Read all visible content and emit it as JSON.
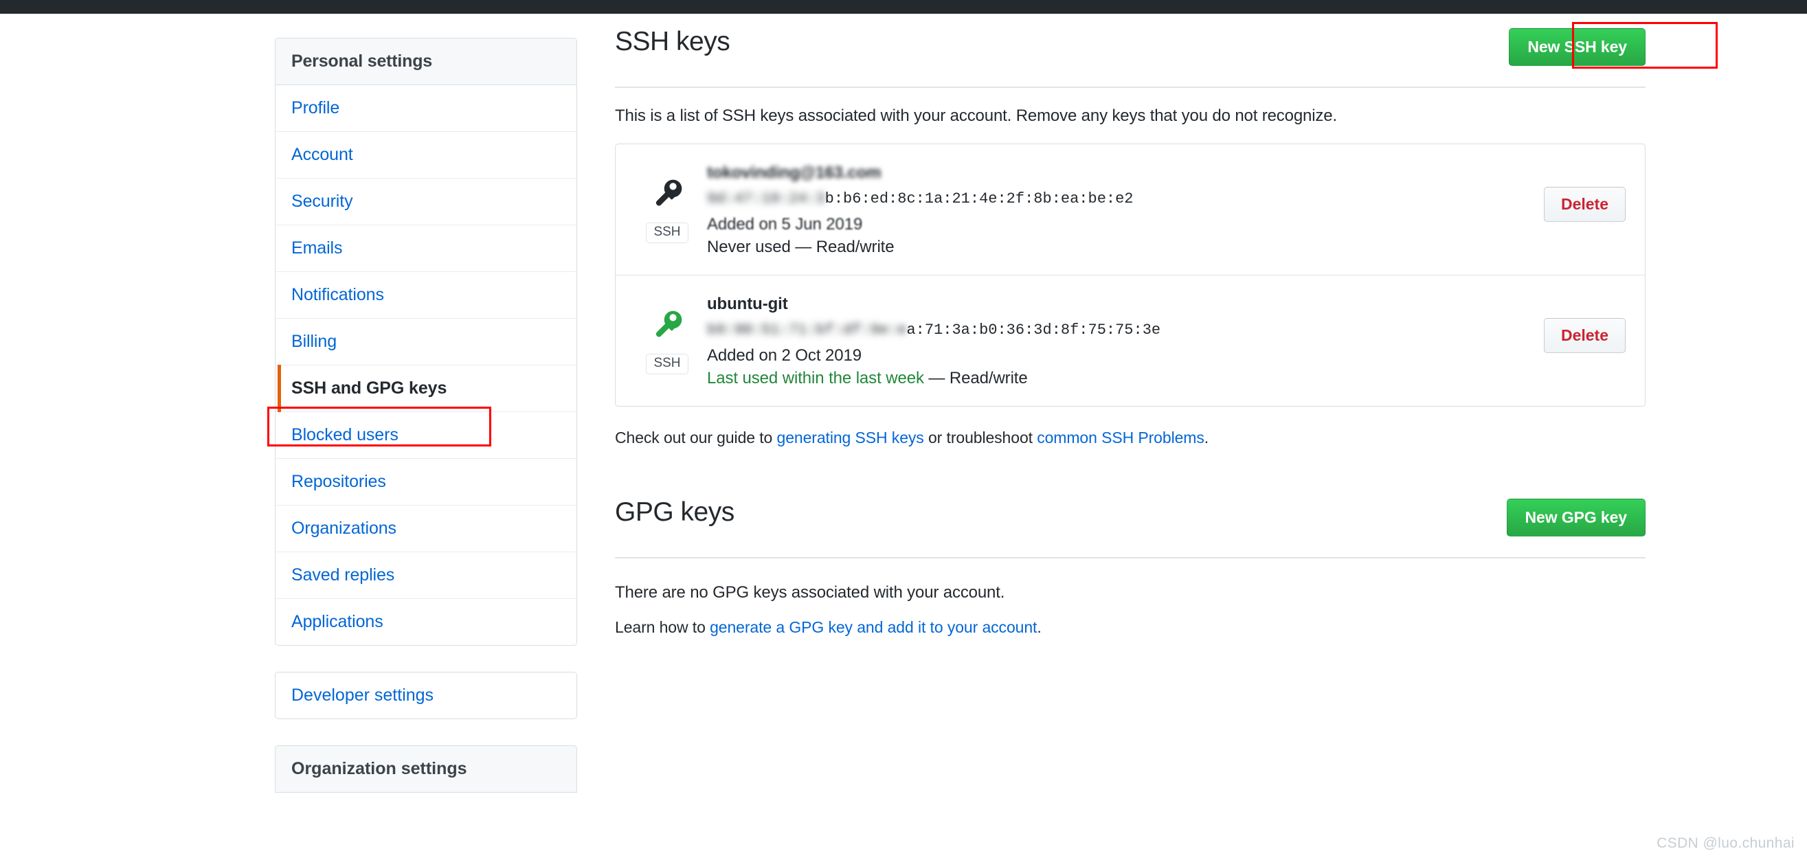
{
  "topbar": {
    "color": "#24292e"
  },
  "sidebar": {
    "personal": {
      "header": "Personal settings",
      "items": [
        {
          "label": "Profile",
          "selected": false
        },
        {
          "label": "Account",
          "selected": false
        },
        {
          "label": "Security",
          "selected": false
        },
        {
          "label": "Emails",
          "selected": false
        },
        {
          "label": "Notifications",
          "selected": false
        },
        {
          "label": "Billing",
          "selected": false
        },
        {
          "label": "SSH and GPG keys",
          "selected": true
        },
        {
          "label": "Blocked users",
          "selected": false
        },
        {
          "label": "Repositories",
          "selected": false
        },
        {
          "label": "Organizations",
          "selected": false
        },
        {
          "label": "Saved replies",
          "selected": false
        },
        {
          "label": "Applications",
          "selected": false
        }
      ]
    },
    "developer_settings": "Developer settings",
    "organization_settings": "Organization settings",
    "selected_indicator_color": "#e36209",
    "link_color": "#0366d6"
  },
  "ssh_section": {
    "title": "SSH keys",
    "new_key_button": "New SSH key",
    "description": "This is a list of SSH keys associated with your account. Remove any keys that you do not recognize.",
    "keys": [
      {
        "title": "tokovinding@163.com",
        "title_blurred": true,
        "fingerprint": "9d:47:19:24:3b:b6:ed:8c:1a:21:4e:2f:8b:ea:be:e2",
        "fingerprint_visible_tail": "b:b6:ed:8c:1a:21:4e:2f:8b:ea:be:e2",
        "added": "Added on 5 Jun 2019",
        "used_text": "Never used",
        "used_color": "#24292e",
        "permission": "Read/write",
        "badge": "SSH",
        "icon": "key-icon",
        "icon_color": "#24292e",
        "delete_label": "Delete"
      },
      {
        "title": "ubuntu-git",
        "title_blurred": false,
        "fingerprint": "b9:90:51:71:bf:df:9e:ea:71:3a:b0:36:3d:8f:75:75:3e",
        "fingerprint_visible_tail": "a:71:3a:b0:36:3d:8f:75:75:3e",
        "added": "Added on 2 Oct 2019",
        "used_text": "Last used within the last week",
        "used_color": "#22863a",
        "permission": "Read/write",
        "badge": "SSH",
        "icon": "key-icon",
        "icon_color": "#28a745",
        "delete_label": "Delete"
      }
    ],
    "guide": {
      "prefix": "Check out our guide to ",
      "link1": "generating SSH keys",
      "middle": " or troubleshoot ",
      "link2": "common SSH Problems",
      "suffix": "."
    }
  },
  "gpg_section": {
    "title": "GPG keys",
    "new_key_button": "New GPG key",
    "empty_message": "There are no GPG keys associated with your account.",
    "learn_prefix": "Learn how to ",
    "learn_link": "generate a GPG key and add it to your account",
    "learn_suffix": "."
  },
  "annotations": {
    "color": "#fe0000",
    "targets": [
      "New SSH key button",
      "SSH and GPG keys sidebar item"
    ]
  },
  "watermark": "CSDN @luo.chunhai"
}
